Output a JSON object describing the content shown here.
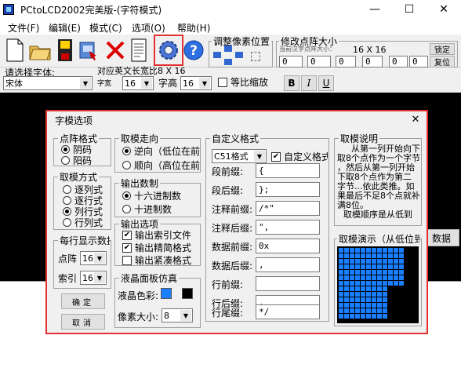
{
  "window": {
    "title": "PCtoLCD2002完美版-(字符模式)",
    "minimize_glyph": "—",
    "maximize_glyph": "☐",
    "close_glyph": "✕"
  },
  "menu": [
    "文件(F)",
    "编辑(E)",
    "模式(C)",
    "选项(O)",
    "帮助(H)"
  ],
  "toolbar": {
    "pixel_adjust_label": "调整像素位置",
    "dot_size_label": "修改点阵大小",
    "current_size_hint": "当前汉字点阵大小：",
    "current_size_value": "16 X 16",
    "lock_label": "锁定",
    "reset_label": "复位",
    "size_w": "0",
    "size_h": "0",
    "offset_l": "0",
    "offset_r": "0",
    "offset_t": "0",
    "offset_b": "0"
  },
  "font_bar": {
    "font_label": "请选择字体:",
    "font_value": "宋体",
    "ascii_label": "对应英文长宽比8 X 16",
    "char_width_label": "字宽",
    "char_width_value": "16",
    "char_height_label": "字高",
    "char_height_value": "16",
    "ratio_label": "等比缩放",
    "bold_label": "B",
    "italic_label": "I",
    "underline_label": "U"
  },
  "behind": {
    "right_btn_label": "数据"
  },
  "dialog": {
    "title": "字模选项",
    "close_glyph": "✕",
    "dot_format": {
      "label": "点阵格式",
      "options": [
        "阴码",
        "阳码"
      ],
      "selected": 0
    },
    "take_mode": {
      "label": "取模方式",
      "options": [
        "逐列式",
        "逐行式",
        "列行式",
        "行列式"
      ],
      "selected": 2
    },
    "per_line": {
      "label": "每行显示数据",
      "dot_label": "点阵",
      "dot_value": "16",
      "index_label": "索引",
      "index_value": "16"
    },
    "ok_label": "确定",
    "cancel_label": "取消",
    "direction": {
      "label": "取模走向",
      "options": [
        "逆向（低位在前）",
        "顺向（高位在前）"
      ],
      "selected": 0
    },
    "radix": {
      "label": "输出数制",
      "options": [
        "十六进制数",
        "十进制数"
      ],
      "selected": 0
    },
    "output": {
      "label": "输出选项",
      "options": [
        {
          "label": "输出索引文件",
          "checked": true
        },
        {
          "label": "输出精简格式",
          "checked": true
        },
        {
          "label": "输出紧凑格式",
          "checked": false
        }
      ]
    },
    "lcd": {
      "label": "液晶面板仿真",
      "color_label": "液晶色彩:",
      "on_color": "#1a7fff",
      "off_color": "#000000",
      "pixel_size_label": "像素大小:",
      "pixel_size_value": "8"
    },
    "custom": {
      "label": "自定义格式",
      "format_value": "C51格式",
      "custom_check_label": "自定义格式",
      "custom_checked": true,
      "fields": [
        {
          "label": "段前缀:",
          "value": "{"
        },
        {
          "label": "段后缀:",
          "value": "};"
        },
        {
          "label": "注释前缀:",
          "value": "/*\""
        },
        {
          "label": "注释后缀:",
          "value": "\","
        },
        {
          "label": "数据前缀:",
          "value": "0x"
        },
        {
          "label": "数据后缀:",
          "value": ","
        },
        {
          "label": "行前缀:",
          "value": ""
        },
        {
          "label": "行后缀:",
          "value": ","
        },
        {
          "label": "行尾缀:",
          "value": "*/"
        }
      ]
    },
    "explain": {
      "label": "取模说明",
      "lines": [
        "从第一列开始向下",
        "取8个点作为一个字节",
        "，然后从第一列开始",
        "下取8个点作为第二",
        "字节...依此类推。如",
        "果最后不足8个点就补",
        "满8位。",
        "取模顺序是从低到"
      ]
    },
    "demo": {
      "label": "取模演示（从低位到高位）"
    }
  }
}
